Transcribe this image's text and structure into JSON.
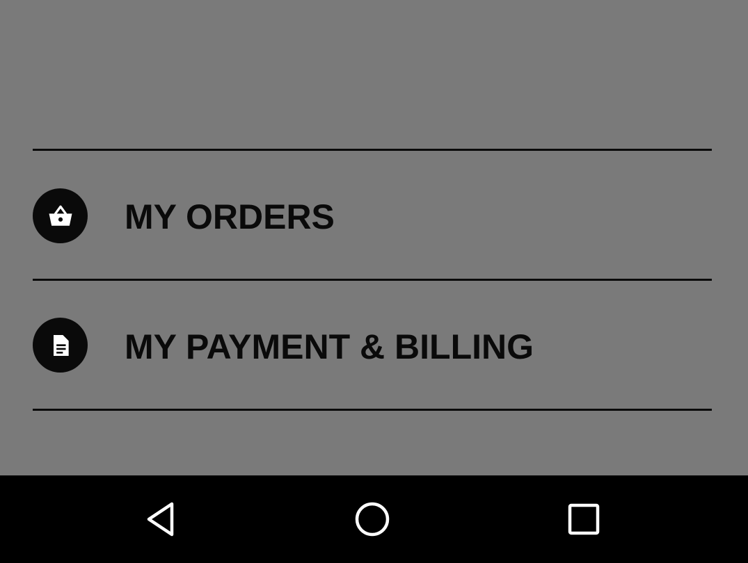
{
  "menu": {
    "items": [
      {
        "label": "MY ORDERS",
        "icon": "basket-icon"
      },
      {
        "label": "MY PAYMENT & BILLING",
        "icon": "document-icon"
      }
    ]
  },
  "colors": {
    "screen_background": "#7a7a7a",
    "foreground": "#0a0a0a",
    "navbar_background": "#000000",
    "navbar_icons": "#ffffff"
  },
  "navbar": {
    "buttons": [
      "back-icon",
      "home-icon",
      "recents-icon"
    ]
  }
}
